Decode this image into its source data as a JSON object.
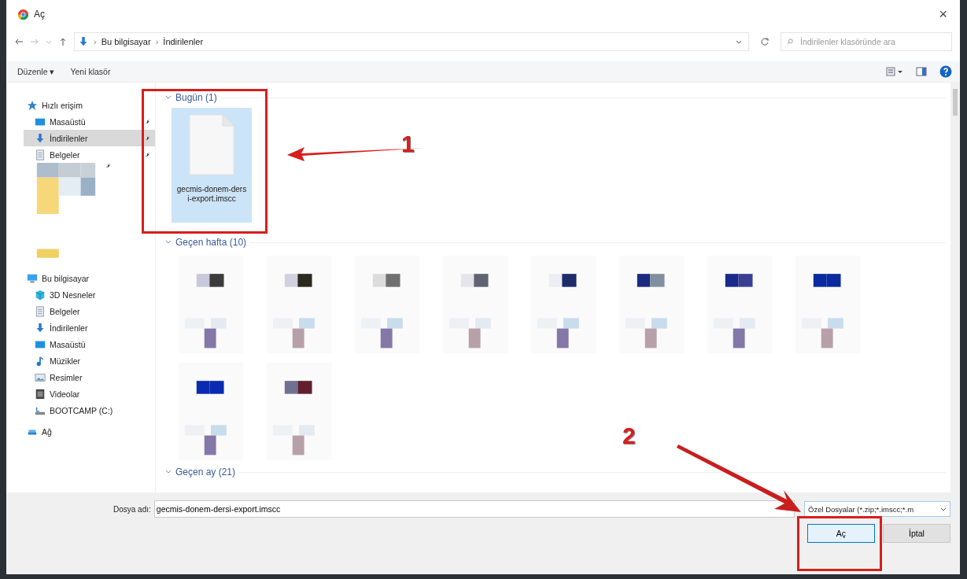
{
  "window": {
    "title": "Aç",
    "close": "×"
  },
  "address": {
    "crumbs": [
      {
        "sep": "›",
        "label": "Bu bilgisayar"
      },
      {
        "sep": "›",
        "label": "İndirilenler"
      }
    ],
    "search_placeholder": "İndirilenler klasöründe ara"
  },
  "toolbar": {
    "organize": "Düzenle ▾",
    "new_folder": "Yeni klasör"
  },
  "sidebar": [
    {
      "kind": "star",
      "label": "Hızlı erişim",
      "selected": false,
      "pinned": false,
      "children": [
        {
          "kind": "desktop",
          "label": "Masaüstü",
          "selected": false,
          "pinned": true
        },
        {
          "kind": "download",
          "label": "İndirilenler",
          "selected": true,
          "pinned": true
        },
        {
          "kind": "documents",
          "label": "Belgeler",
          "selected": false,
          "pinned": true
        },
        {
          "kind": "picture",
          "pinned": true
        }
      ]
    },
    {
      "kind": "pc",
      "label": "Bu bilgisayar",
      "selected": false,
      "pinned": false,
      "children": [
        {
          "kind": "cube",
          "label": "3D Nesneler",
          "selected": false,
          "pinned": false
        },
        {
          "kind": "documents",
          "label": "Belgeler",
          "selected": false,
          "pinned": false
        },
        {
          "kind": "download",
          "label": "İndirilenler",
          "selected": false,
          "pinned": false
        },
        {
          "kind": "desktop",
          "label": "Masaüstü",
          "selected": false,
          "pinned": false
        },
        {
          "kind": "music",
          "label": "Müzikler",
          "selected": false,
          "pinned": false
        },
        {
          "kind": "pictures",
          "label": "Resimler",
          "selected": false,
          "pinned": false
        },
        {
          "kind": "videos",
          "label": "Videolar",
          "selected": false,
          "pinned": false
        },
        {
          "kind": "drive",
          "label": "BOOTCAMP (C:)",
          "selected": false,
          "pinned": false
        }
      ]
    },
    {
      "kind": "network",
      "label": "Ağ",
      "selected": false,
      "pinned": false
    }
  ],
  "groups": [
    {
      "label": "Bugün (1)",
      "items": [
        {
          "kind": "file",
          "name": "gecmis-donem-dersi-export.imscc",
          "selected": true
        }
      ]
    },
    {
      "label": "Geçen hafta (10)",
      "items": [
        {
          "kind": "picture"
        },
        {
          "kind": "picture"
        },
        {
          "kind": "picture"
        },
        {
          "kind": "picture"
        },
        {
          "kind": "picture"
        },
        {
          "kind": "picture"
        },
        {
          "kind": "picture"
        },
        {
          "kind": "picture"
        },
        {
          "kind": "picture"
        },
        {
          "kind": "picture"
        }
      ]
    },
    {
      "label": "Geçen ay (21)"
    }
  ],
  "footer": {
    "filename_label": "Dosya adı:",
    "filename": "gecmis-donem-dersi-export.imscc",
    "filetype": "Özel Dosyalar (*.zip;*.imscc;*.m",
    "open": "Aç",
    "cancel": "İptal"
  },
  "annotations": [
    {
      "number": "1"
    },
    {
      "number": "2"
    }
  ]
}
